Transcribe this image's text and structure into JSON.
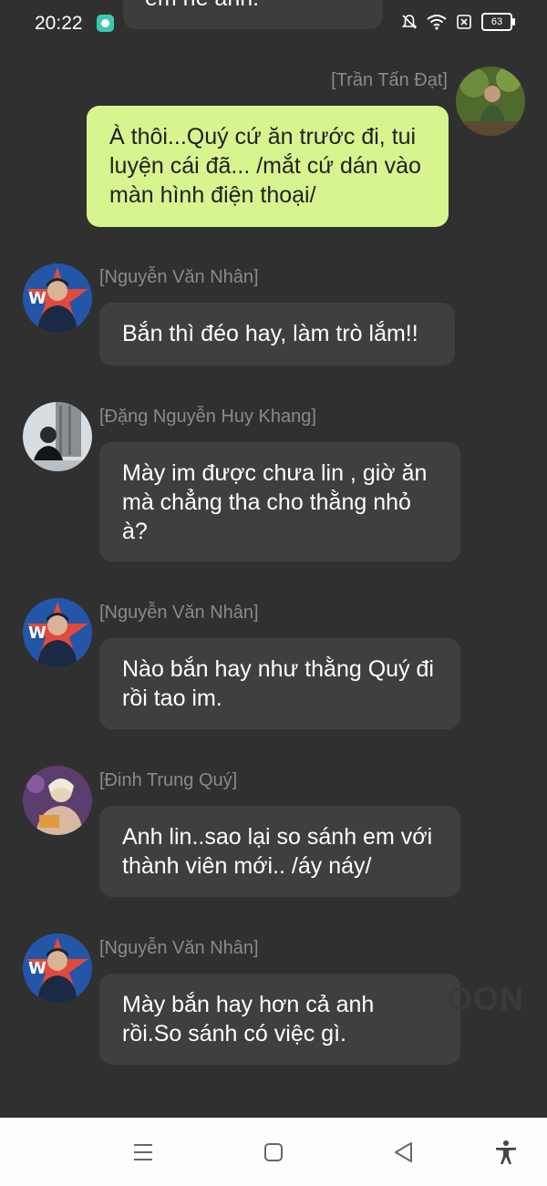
{
  "status_bar": {
    "time": "20:22",
    "battery": "63"
  },
  "top_cut_message": "em nề anh.",
  "watermark": "OON",
  "messages": [
    {
      "sender": "[Trần Tấn Đạt]",
      "text": "À thôi...Quý cứ ăn trước đi, tui luyện cái đã... /mắt cứ dán vào màn hình điện thoại/",
      "own": true
    },
    {
      "sender": "[Nguyễn Văn Nhân]",
      "text": "Bắn thì đéo hay, làm trò lắm!!"
    },
    {
      "sender": "[Đặng Nguyễn Huy Khang]",
      "text": "Mày im được chưa lin , giờ ăn mà chẳng tha cho thằng nhỏ à?"
    },
    {
      "sender": "[Nguyễn Văn Nhân]",
      "text": "Nào bắn hay như thằng Quý đi rồi tao im."
    },
    {
      "sender": "[Đinh Trung Quý]",
      "text": "Anh lin..sao lại so sánh em với thành viên mới.. /áy náy/"
    },
    {
      "sender": "[Nguyễn Văn Nhân]",
      "text": "Mày bắn hay hơn cả anh rồi.So sánh có việc gì."
    }
  ],
  "colors": {
    "background": "#303030",
    "bubble": "#3f3f3f",
    "own_bubble": "#d7f48f",
    "sender": "#8a8a8a"
  }
}
